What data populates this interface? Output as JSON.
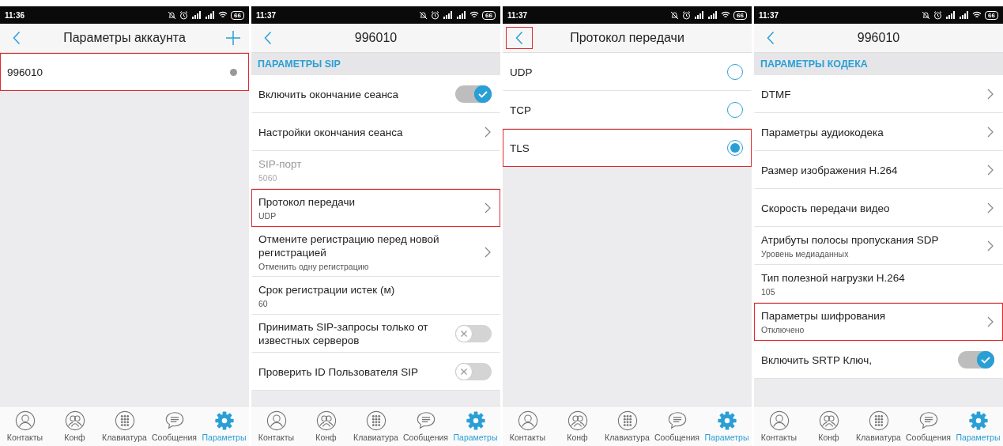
{
  "panels": [
    {
      "status": {
        "time": "11:36",
        "battery": "66"
      },
      "header": {
        "title": "Параметры аккаунта",
        "back_highlighted": false,
        "add_button": true
      },
      "rows": [
        {
          "kind": "account",
          "label": "996010",
          "highlighted": true
        }
      ],
      "nav": [
        {
          "label": "Контакты",
          "selected": false
        },
        {
          "label": "Конф",
          "selected": false
        },
        {
          "label": "Клавиатура",
          "selected": false
        },
        {
          "label": "Сообщения",
          "selected": false
        },
        {
          "label": "Параметры",
          "selected": true
        }
      ]
    },
    {
      "status": {
        "time": "11:37",
        "battery": "66"
      },
      "header": {
        "title": "996010",
        "back_highlighted": false,
        "add_button": false
      },
      "section": "ПАРАМЕТРЫ SIP",
      "rows": [
        {
          "kind": "toggle",
          "label": "Включить окончание сеанса",
          "on": true,
          "highlighted": false
        },
        {
          "kind": "link",
          "label": "Настройки окончания сеанса",
          "highlighted": false
        },
        {
          "kind": "value",
          "label": "SIP-порт",
          "sublabel": "5060",
          "disabled": true,
          "highlighted": false
        },
        {
          "kind": "link",
          "label": "Протокол передачи",
          "sublabel": "UDP",
          "highlighted": true
        },
        {
          "kind": "link",
          "label": "Отмените регистрацию перед новой регистрацией",
          "sublabel": "Отменить одну регистрацию",
          "highlighted": false
        },
        {
          "kind": "value",
          "label": "Срок регистрации истек (м)",
          "sublabel": "60",
          "disabled": false,
          "highlighted": false
        },
        {
          "kind": "toggle",
          "label": "Принимать SIP-запросы только от известных серверов",
          "on": false,
          "highlighted": false
        },
        {
          "kind": "toggle",
          "label": "Проверить ID Пользователя SIP",
          "on": false,
          "highlighted": false
        }
      ],
      "nav": [
        {
          "label": "Контакты",
          "selected": false
        },
        {
          "label": "Конф",
          "selected": false
        },
        {
          "label": "Клавиатура",
          "selected": false
        },
        {
          "label": "Сообщения",
          "selected": false
        },
        {
          "label": "Параметры",
          "selected": true
        }
      ]
    },
    {
      "status": {
        "time": "11:37",
        "battery": "66"
      },
      "header": {
        "title": "Протокол передачи",
        "back_highlighted": true,
        "add_button": false
      },
      "rows": [
        {
          "kind": "radio",
          "label": "UDP",
          "selected": false,
          "highlighted": false
        },
        {
          "kind": "radio",
          "label": "TCP",
          "selected": false,
          "highlighted": false
        },
        {
          "kind": "radio",
          "label": "TLS",
          "selected": true,
          "highlighted": true
        }
      ],
      "nav": [
        {
          "label": "Контакты",
          "selected": false
        },
        {
          "label": "Конф",
          "selected": false
        },
        {
          "label": "Клавиатура",
          "selected": false
        },
        {
          "label": "Сообщения",
          "selected": false
        },
        {
          "label": "Параметры",
          "selected": true
        }
      ]
    },
    {
      "status": {
        "time": "11:37",
        "battery": "66"
      },
      "header": {
        "title": "996010",
        "back_highlighted": false,
        "add_button": false
      },
      "section": "ПАРАМЕТРЫ КОДЕКА",
      "rows": [
        {
          "kind": "link",
          "label": "DTMF",
          "highlighted": false
        },
        {
          "kind": "link",
          "label": "Параметры аудиокодека",
          "highlighted": false
        },
        {
          "kind": "link",
          "label": "Размер изображения H.264",
          "highlighted": false
        },
        {
          "kind": "link",
          "label": "Скорость передачи видео",
          "highlighted": false
        },
        {
          "kind": "link",
          "label": "Атрибуты полосы пропускания SDP",
          "sublabel": "Уровень медиаданных",
          "highlighted": false
        },
        {
          "kind": "value",
          "label": "Тип полезной нагрузки H.264",
          "sublabel": "105",
          "disabled": false,
          "highlighted": false
        },
        {
          "kind": "link",
          "label": "Параметры шифрования",
          "sublabel": "Отключено",
          "highlighted": true
        },
        {
          "kind": "toggle",
          "label": "Включить SRTP Ключ,",
          "on": true,
          "highlighted": false
        }
      ],
      "nav": [
        {
          "label": "Контакты",
          "selected": false
        },
        {
          "label": "Конф",
          "selected": false
        },
        {
          "label": "Клавиатура",
          "selected": false
        },
        {
          "label": "Сообщения",
          "selected": false
        },
        {
          "label": "Параметры",
          "selected": true
        }
      ]
    }
  ]
}
